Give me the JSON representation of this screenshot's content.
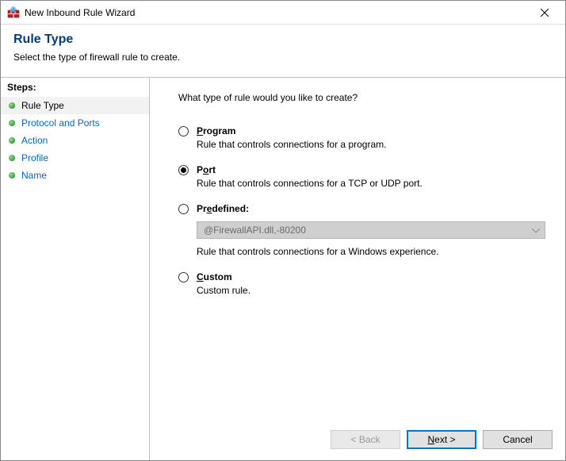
{
  "window": {
    "title": "New Inbound Rule Wizard"
  },
  "header": {
    "title": "Rule Type",
    "subtitle": "Select the type of firewall rule to create."
  },
  "steps": {
    "heading": "Steps:",
    "items": [
      {
        "label": "Rule Type",
        "active": true
      },
      {
        "label": "Protocol and Ports",
        "link": true
      },
      {
        "label": "Action",
        "link": true
      },
      {
        "label": "Profile",
        "link": true
      },
      {
        "label": "Name",
        "link": true
      }
    ]
  },
  "content": {
    "prompt": "What type of rule would you like to create?",
    "options": {
      "program": {
        "accel": "P",
        "rest": "rogram",
        "desc": "Rule that controls connections for a program."
      },
      "port": {
        "label_pre": "P",
        "accel": "o",
        "label_post": "rt",
        "desc": "Rule that controls connections for a TCP or UDP port."
      },
      "predefined": {
        "label_pre": "Pr",
        "accel": "e",
        "label_post": "defined:",
        "dropdown_value": "@FirewallAPI.dll,-80200",
        "desc": "Rule that controls connections for a Windows experience."
      },
      "custom": {
        "accel": "C",
        "rest": "ustom",
        "desc": "Custom rule."
      }
    },
    "selected": "port"
  },
  "buttons": {
    "back": "< Back",
    "next_accel": "N",
    "next_rest": "ext >",
    "cancel": "Cancel"
  }
}
